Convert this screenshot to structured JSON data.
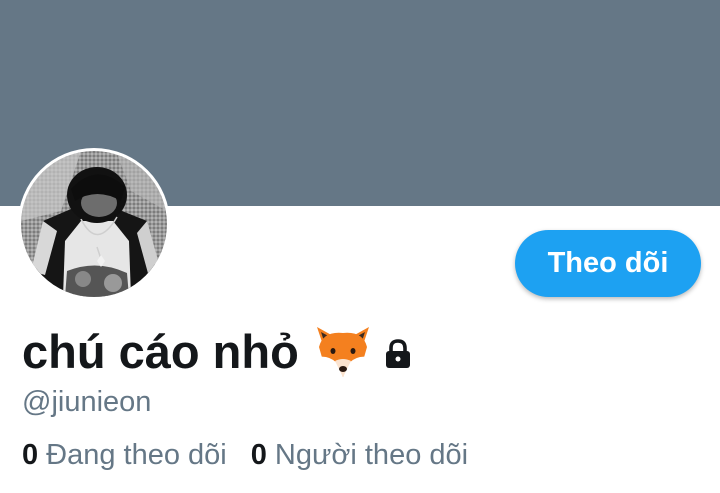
{
  "profile": {
    "display_name": "chú cáo nhỏ",
    "name_emoji_icon": "fox-face-icon",
    "protected_icon": "lock-icon",
    "handle": "@jiunieon",
    "follow_button_label": "Theo dõi",
    "stats": {
      "following_count": "0",
      "following_label": "Đang theo dõi",
      "followers_count": "0",
      "followers_label": "Người theo dõi"
    }
  },
  "colors": {
    "banner": "#657786",
    "accent": "#1da1f2",
    "text_primary": "#14171a",
    "text_secondary": "#657786"
  }
}
